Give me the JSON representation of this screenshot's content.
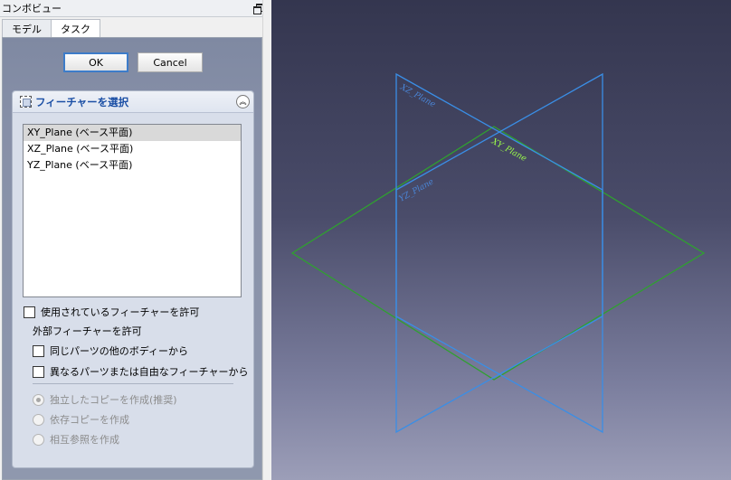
{
  "combo_view": {
    "title": "コンボビュー",
    "tabs": [
      "モデル",
      "タスク"
    ]
  },
  "buttons": {
    "ok": "OK",
    "cancel": "Cancel"
  },
  "feature_panel": {
    "title": "フィーチャーを選択",
    "items": [
      "XY_Plane (ベース平面)",
      "XZ_Plane (ベース平面)",
      "YZ_Plane (ベース平面)"
    ],
    "selected_index": 0
  },
  "options": {
    "allow_used": "使用されているフィーチャーを許可",
    "external_header": "外部フィーチャーを許可",
    "same_part_other_body": "同じパーツの他のボディーから",
    "different_part": "異なるパーツまたは自由なフィーチャーから",
    "radio_independent": "独立したコピーを作成(推奨)",
    "radio_dependent": "依存コピーを作成",
    "radio_cross_ref": "相互参照を作成"
  },
  "view": {
    "labels": {
      "xz": "XZ_Plane",
      "xy": "XY_Plane",
      "yz": "YZ_Plane"
    },
    "colors": {
      "xy": "#2fa12f",
      "xz": "#3a8ee6",
      "yz": "#3a8ee6",
      "xy_label": "#9dff4a",
      "xz_label": "#4a86d8"
    }
  }
}
